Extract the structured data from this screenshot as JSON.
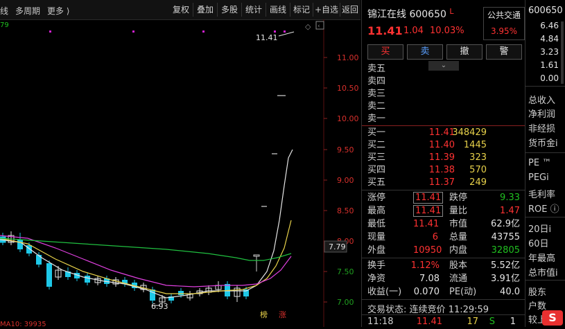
{
  "toolbar": {
    "left_items": [
      "线",
      "多周期",
      "更多 ⟩"
    ],
    "buttons": [
      "复权",
      "叠加",
      "多股",
      "统计",
      "画线",
      "标记",
      "+自选",
      "返回"
    ]
  },
  "chart": {
    "ma_label_top": "79",
    "ma_label_bottom": "MA10: 39935",
    "price_ticks": [
      "11.00",
      "10.50",
      "10.00",
      "9.50",
      "9.00",
      "8.50",
      "8.00",
      "7.50",
      "7.00"
    ],
    "current_price_tag": "7.79",
    "high_annot": "11.41",
    "low_annot": "6.93",
    "tag_bang": "榜",
    "tag_zhang": "涨"
  },
  "stock": {
    "name": "锦江在线",
    "code": "600650",
    "flag": "L",
    "category": "公共交通",
    "category_pct": "3.95%",
    "price": "11.41",
    "change": "1.04",
    "change_pct": "10.03%"
  },
  "trade_buttons": [
    "买",
    "卖",
    "撤",
    "警"
  ],
  "ask": [
    "卖五",
    "卖四",
    "卖三",
    "卖二",
    "卖一"
  ],
  "bid": [
    {
      "label": "买一",
      "price": "11.41",
      "vol": "348429"
    },
    {
      "label": "买二",
      "price": "11.40",
      "vol": "1445"
    },
    {
      "label": "买三",
      "price": "11.39",
      "vol": "323"
    },
    {
      "label": "买四",
      "price": "11.38",
      "vol": "570"
    },
    {
      "label": "买五",
      "price": "11.37",
      "vol": "249"
    }
  ],
  "stats1": [
    {
      "l1": "涨停",
      "v1": "11.41",
      "l2": "跌停",
      "v2": "9.33"
    },
    {
      "l1": "最高",
      "v1": "11.41",
      "l2": "量比",
      "v2": "1.47"
    },
    {
      "l1": "最低",
      "v1": "11.41",
      "l2": "市值",
      "v2": "62.9亿"
    },
    {
      "l1": "现量",
      "v1": "6",
      "l2": "总量",
      "v2": "43755"
    },
    {
      "l1": "外盘",
      "v1": "10950",
      "l2": "内盘",
      "v2": "32805"
    }
  ],
  "stats2": [
    {
      "l1": "换手",
      "v1": "1.12%",
      "l2": "股本",
      "v2": "5.52亿"
    },
    {
      "l1": "净资",
      "v1": "7.08",
      "l2": "流通",
      "v2": "3.91亿"
    },
    {
      "l1": "收益(一)",
      "v1": "0.070",
      "l2": "PE(动)",
      "v2": "40.0"
    }
  ],
  "status": {
    "label": "交易状态:",
    "value": "连续竞价",
    "time": "11:29:59"
  },
  "tick": {
    "time": "11:18",
    "price": "11.41",
    "vol": "17",
    "side": "S",
    "count": "1"
  },
  "far": {
    "code": "600650",
    "nums": [
      "6.46",
      "4.84",
      "3.23",
      "1.61",
      "0.00"
    ],
    "items1": [
      "总收入",
      "净利润",
      "非经损",
      "货币金i"
    ],
    "items2": [
      "PE ™",
      "PEGi",
      "毛利率",
      "ROE ⓘ"
    ],
    "items3": [
      "20日i",
      "60日",
      "年最高",
      "总市值i"
    ],
    "items4": [
      "股东",
      "户数",
      "较上"
    ]
  }
}
